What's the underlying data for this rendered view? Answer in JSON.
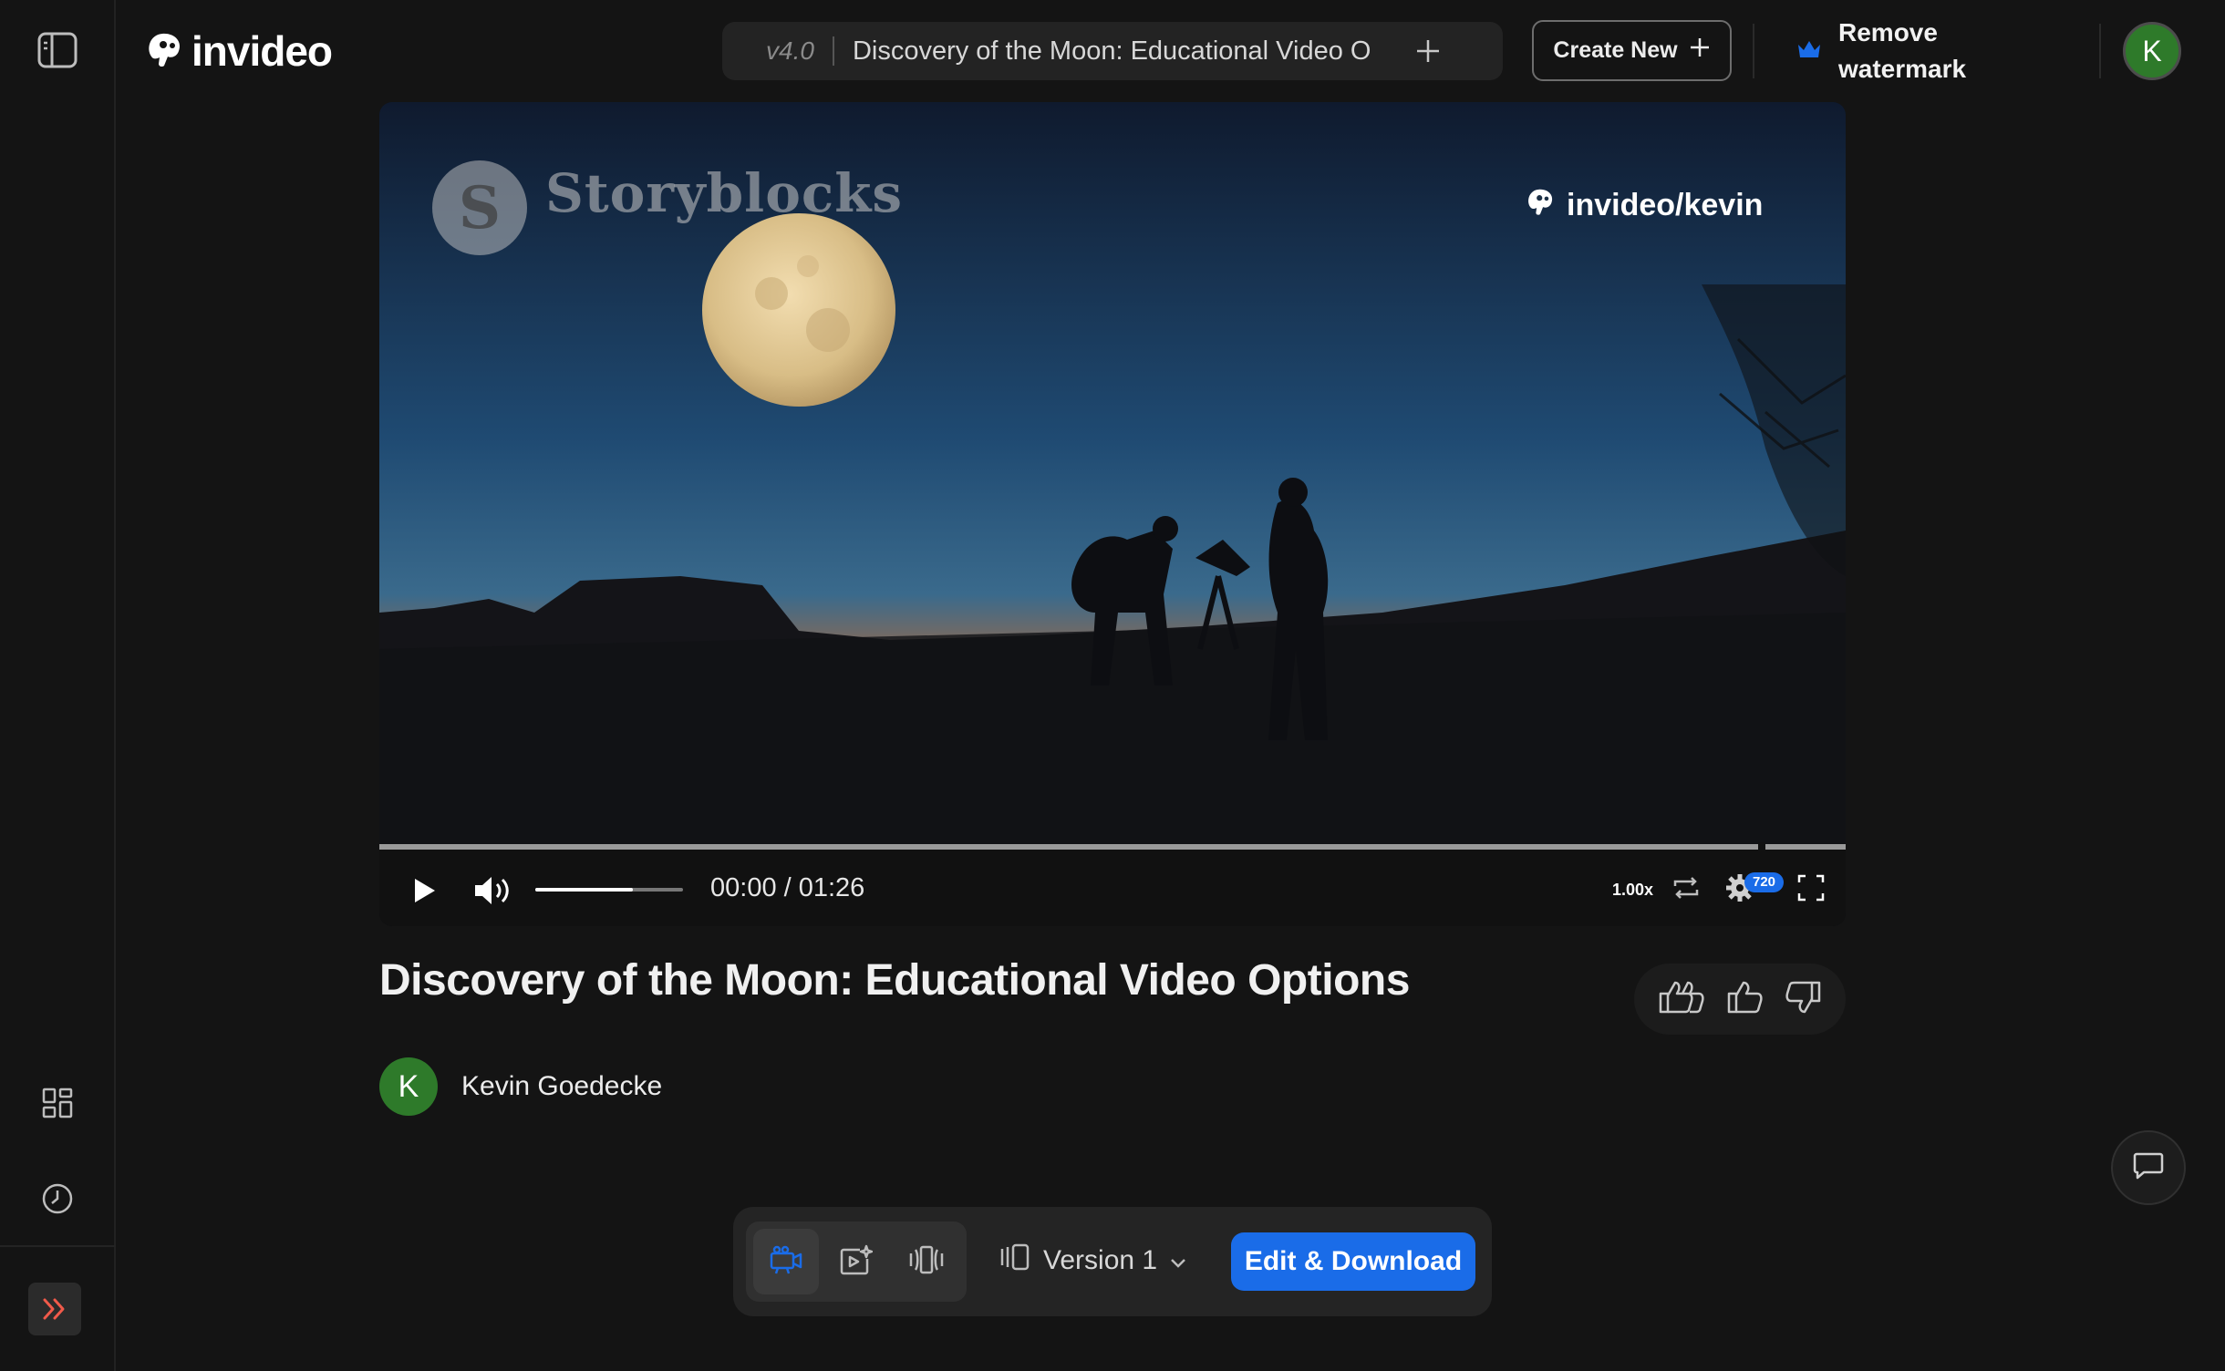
{
  "app": {
    "brand": "invideo",
    "version": "v4.0",
    "doc_title": "Discovery of the Moon: Educational Video Options",
    "create_new_label": "Create New",
    "remove_watermark_label": "Remove watermark",
    "user_initial": "K",
    "accent_color": "#1a6ce8"
  },
  "sidebar": {
    "icons": [
      "sidebar-toggle-icon",
      "grid-icon",
      "history-icon",
      "expand-icon"
    ]
  },
  "player": {
    "overlay_watermark": "Storyblocks",
    "overlay_brand": "invideo/kevin",
    "time_display": "00:00 / 01:26",
    "speed": "1.00x",
    "quality": "720",
    "progress_fraction": 0.94,
    "volume_fraction": 0.66
  },
  "video": {
    "title": "Discovery of the Moon: Educational Video Options",
    "author_initial": "K",
    "author_name": "Kevin Goedecke"
  },
  "dock": {
    "version_label": "Version 1",
    "edit_download_label": "Edit & Download"
  }
}
